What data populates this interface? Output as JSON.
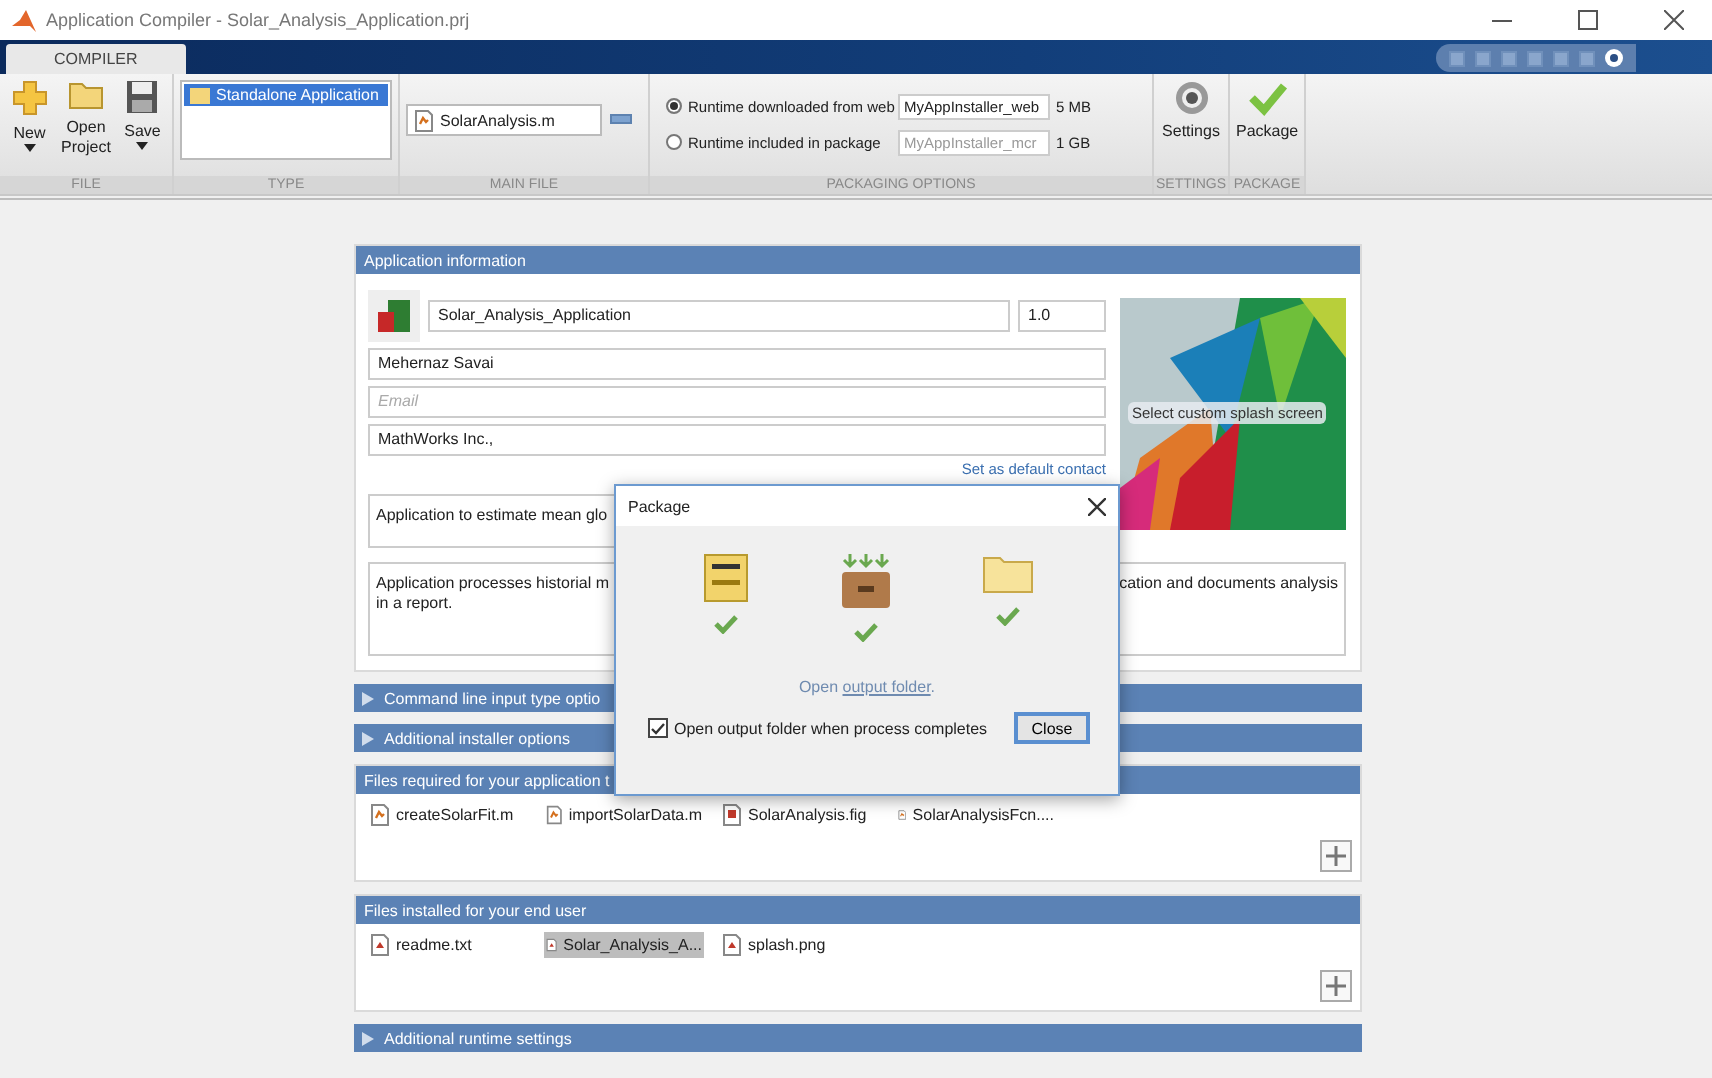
{
  "window": {
    "title": "Application Compiler - Solar_Analysis_Application.prj"
  },
  "tabs": [
    {
      "label": "COMPILER",
      "selected": true
    }
  ],
  "ribbon": {
    "file_buttons": [
      {
        "label": "New",
        "kind": "new",
        "dropdown": true
      },
      {
        "label": "Open Project",
        "kind": "open",
        "dropdown": false
      },
      {
        "label": "Save",
        "kind": "save",
        "dropdown": true
      }
    ],
    "types": [
      {
        "label": "Standalone Application",
        "selected": true
      }
    ],
    "main_file": "SolarAnalysis.m",
    "packaging_options": [
      {
        "label": "Runtime downloaded from web",
        "selected": true,
        "value": "MyAppInstaller_web",
        "size": "5 MB",
        "disabled": false
      },
      {
        "label": "Runtime included in package",
        "selected": false,
        "value": "MyAppInstaller_mcr",
        "size": "1 GB",
        "disabled": true
      }
    ],
    "settings": "Settings",
    "package": "Package",
    "group_labels": [
      "FILE",
      "TYPE",
      "MAIN FILE",
      "PACKAGING OPTIONS",
      "SETTINGS",
      "PACKAGE"
    ]
  },
  "app_info": {
    "header": "Application information",
    "name": "Solar_Analysis_Application",
    "version": "1.0",
    "author": "Mehernaz Savai",
    "email_placeholder": "Email",
    "company": "MathWorks Inc.,",
    "default_contact_link": "Set as default contact",
    "summary": "Application to estimate mean glo",
    "description_left": [
      "Application processes historial m",
      "in a report."
    ],
    "description_right": "cation and documents analysis",
    "splash": "Select custom splash screen"
  },
  "sections": [
    {
      "kind": "collapsed",
      "title": "Command line input type optio"
    },
    {
      "kind": "collapsed",
      "title": "Additional installer options"
    },
    {
      "kind": "files",
      "title": "Files required for your application t",
      "files": [
        {
          "name": "createSolarFit.m",
          "kind": "script",
          "selected": false
        },
        {
          "name": "importSolarData.m",
          "kind": "script",
          "selected": false
        },
        {
          "name": "SolarAnalysis.fig",
          "kind": "figure",
          "selected": false
        },
        {
          "name": "SolarAnalysisFcn....",
          "kind": "script",
          "selected": false
        }
      ]
    },
    {
      "kind": "files",
      "title": "Files installed for your end user",
      "files": [
        {
          "name": "readme.txt",
          "kind": "document",
          "selected": false
        },
        {
          "name": "Solar_Analysis_A...",
          "kind": "document",
          "selected": true
        },
        {
          "name": "splash.png",
          "kind": "document",
          "selected": false
        }
      ]
    },
    {
      "kind": "collapsed",
      "title": "Additional runtime settings"
    }
  ],
  "dialog": {
    "title": "Package",
    "steps": [
      {
        "kind": "binary",
        "done": true
      },
      {
        "kind": "box",
        "done": true
      },
      {
        "kind": "folder",
        "done": true
      }
    ],
    "link_prefix": "Open ",
    "link": "output folder",
    "link_suffix": ".",
    "checkbox": {
      "label": "Open output folder when process completes",
      "checked": true
    },
    "button": "Close"
  }
}
